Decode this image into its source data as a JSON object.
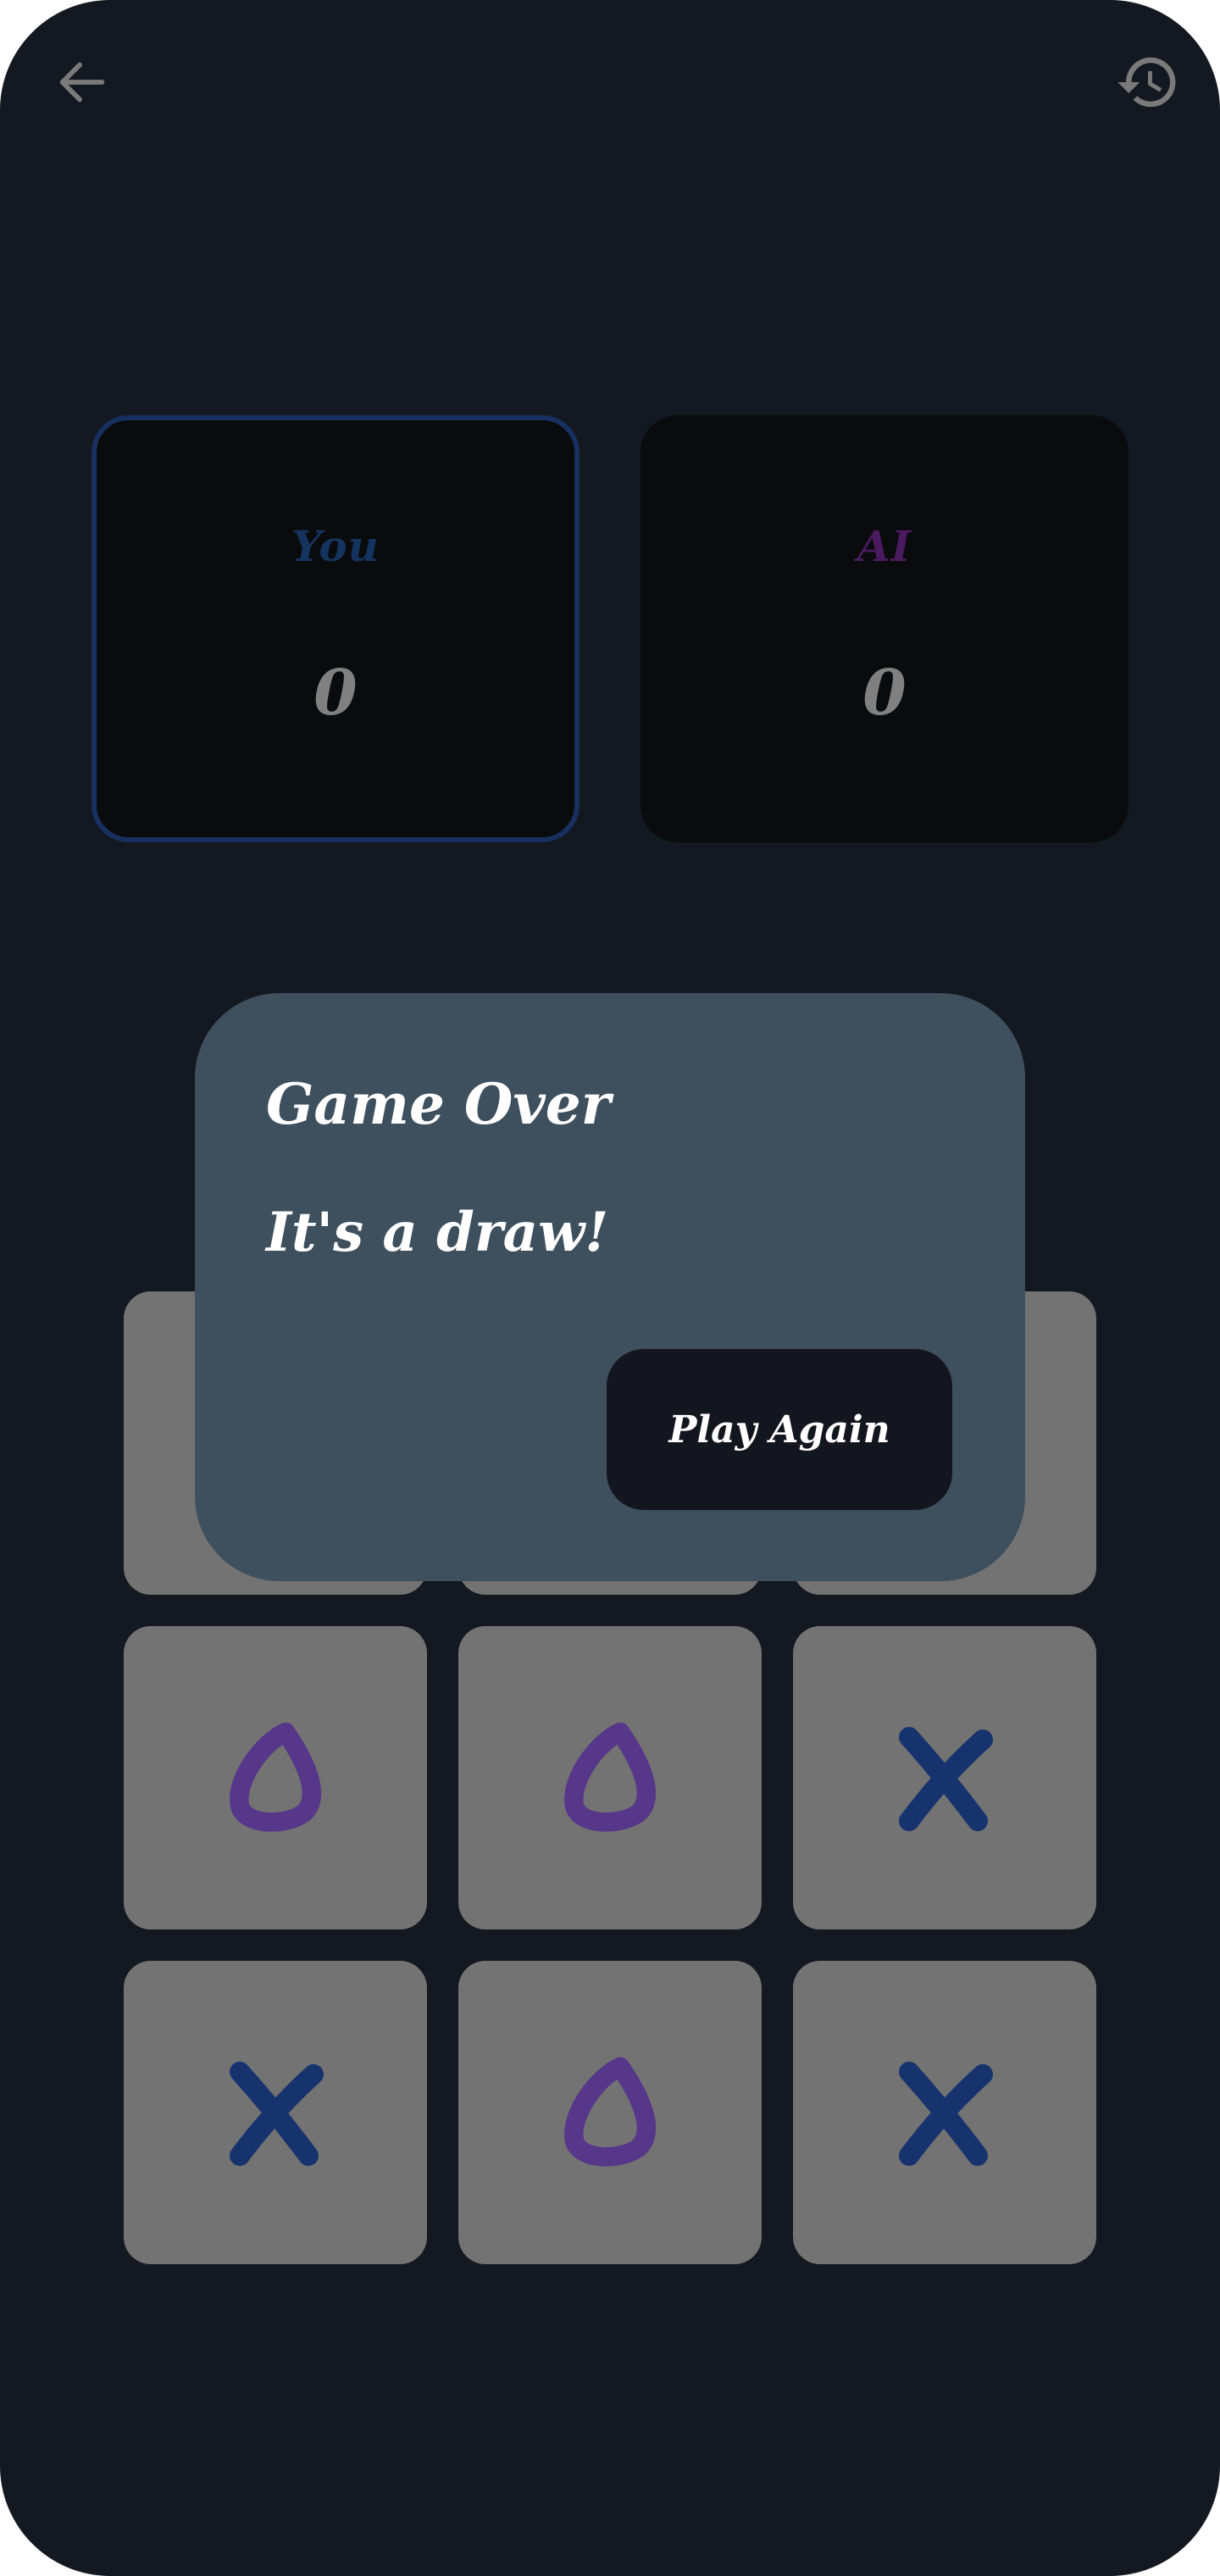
{
  "topbar": {
    "back_icon": "arrow-left-icon",
    "history_icon": "history-icon"
  },
  "scoreboard": {
    "you": {
      "label": "You",
      "score": "0"
    },
    "ai": {
      "label": "AI",
      "score": "0"
    }
  },
  "board": {
    "cells": [
      "",
      "",
      "",
      "O",
      "O",
      "X",
      "X",
      "O",
      "X"
    ]
  },
  "dialog": {
    "title": "Game Over",
    "message": "It's a draw!",
    "button_label": "Play Again"
  },
  "colors": {
    "background": "#141820",
    "x_mark": "#17336e",
    "o_mark": "#56378a",
    "cell": "#737373",
    "dialog": "#3e4f5e",
    "you_accent": "#15335f",
    "ai_accent": "#4a1a5e"
  }
}
